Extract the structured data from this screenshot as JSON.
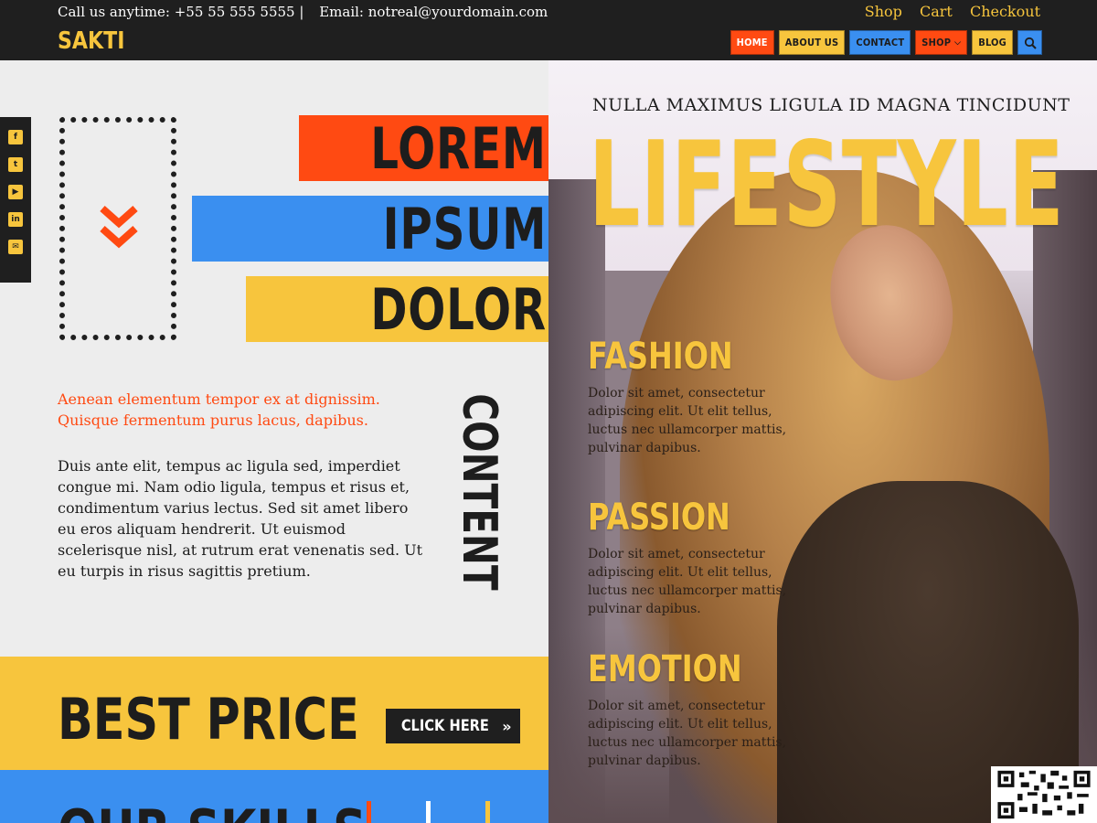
{
  "topbar": {
    "phone_text": "Call us anytime: +55 55 555 5555 |",
    "email_text": "Email: notreal@yourdomain.com",
    "links": {
      "shop": "Shop",
      "cart": "Cart",
      "checkout": "Checkout"
    },
    "logo": "SAKTI",
    "menu": {
      "home": "HOME",
      "about": "ABOUT US",
      "contact": "CONTACT",
      "shop": "SHOP",
      "blog": "BLOG"
    }
  },
  "social": {
    "icons": [
      "facebook-icon",
      "twitter-icon",
      "youtube-icon",
      "linkedin-icon",
      "email-icon"
    ]
  },
  "hero": {
    "band1": "LOREM",
    "band2": "IPSUM",
    "band3": "DOLOR",
    "lead": "Aenean elementum tempor ex at dignissim. Quisque fermentum purus lacus, dapibus.",
    "body": "Duis ante elit, tempus ac ligula sed, imperdiet congue mi. Nam odio ligula, tempus et risus et, condimentum varius lectus. Sed sit amet libero eu eros aliquam hendrerit. Ut euismod scelerisque nisl, at rutrum erat venenatis sed. Ut eu turpis in risus sagittis pretium.",
    "vertical": "CONTENT"
  },
  "cta": {
    "title": "BEST PRICE",
    "button": "CLICK HERE"
  },
  "skills": {
    "title": "OUR SKILLS"
  },
  "magazine": {
    "kicker": "NULLA MAXIMUS LIGULA ID MAGNA TINCIDUNT",
    "headline": "LIFESTYLE",
    "features": [
      {
        "title": "FASHION",
        "text": "Dolor sit amet, consectetur adipiscing elit. Ut elit tellus, luctus nec ullamcorper mattis, pulvinar dapibus."
      },
      {
        "title": "PASSION",
        "text": "Dolor sit amet, consectetur adipiscing elit. Ut elit tellus, luctus nec ullamcorper mattis, pulvinar dapibus."
      },
      {
        "title": "EMOTION",
        "text": "Dolor sit amet, consectetur adipiscing elit. Ut elit tellus, luctus nec ullamcorper mattis, pulvinar dapibus."
      }
    ]
  },
  "colors": {
    "orange": "#ff4a12",
    "blue": "#3a8ff0",
    "yellow": "#f7c53d",
    "dark": "#1f1f1f"
  }
}
